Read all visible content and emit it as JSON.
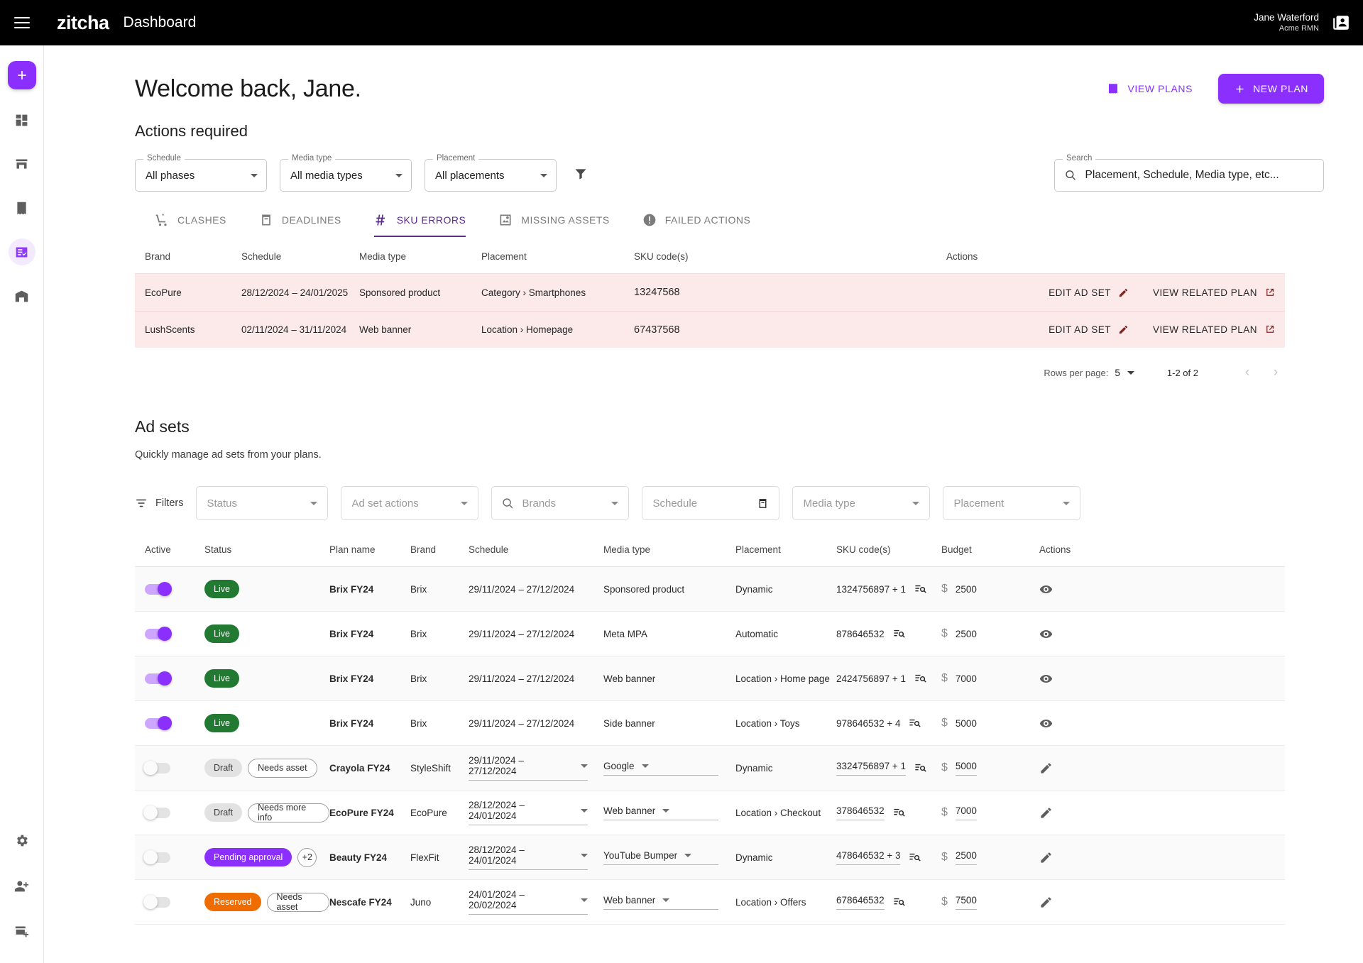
{
  "topbar": {
    "menu_icon": "hamburger-icon",
    "logo": "zitcha",
    "title": "Dashboard",
    "user_name": "Jane Waterford",
    "user_org": "Acme RMN",
    "account_icon": "contact-card-icon"
  },
  "rail": {
    "add_label": "+",
    "items": [
      {
        "icon": "dashboard-grid-icon",
        "name": "sidebar-item-dashboard"
      },
      {
        "icon": "storefront-icon",
        "name": "sidebar-item-retailers"
      },
      {
        "icon": "receipt-icon",
        "name": "sidebar-item-plans"
      },
      {
        "icon": "checklist-icon",
        "name": "sidebar-item-adsets"
      },
      {
        "icon": "warehouse-icon",
        "name": "sidebar-item-inventory"
      }
    ],
    "bottom_items": [
      {
        "icon": "gear-icon",
        "name": "sidebar-item-settings"
      },
      {
        "icon": "person-add-icon",
        "name": "sidebar-item-add-user"
      },
      {
        "icon": "store-add-icon",
        "name": "sidebar-item-add-store"
      }
    ]
  },
  "header": {
    "welcome": "Welcome back, Jane.",
    "view_plans": "VIEW PLANS",
    "new_plan": "NEW PLAN"
  },
  "actions_required": {
    "title": "Actions required",
    "filters": [
      {
        "label": "Schedule",
        "value": "All phases"
      },
      {
        "label": "Media type",
        "value": "All media types"
      },
      {
        "label": "Placement",
        "value": "All placements"
      }
    ],
    "search": {
      "label": "Search",
      "placeholder": "Placement, Schedule, Media type, etc...",
      "value": ""
    },
    "tabs": [
      {
        "label": "CLASHES",
        "icon": "clash-cart-icon",
        "active": false
      },
      {
        "label": "DEADLINES",
        "icon": "calendar-icon",
        "active": false
      },
      {
        "label": "SKU ERRORS",
        "icon": "hash-icon",
        "active": true
      },
      {
        "label": "MISSING ASSETS",
        "icon": "image-search-icon",
        "active": false
      },
      {
        "label": "FAILED ACTIONS",
        "icon": "error-icon",
        "active": false
      }
    ],
    "columns": [
      "Brand",
      "Schedule",
      "Media type",
      "Placement",
      "SKU code(s)",
      "Actions"
    ],
    "rows": [
      {
        "brand": "EcoPure",
        "schedule": "28/12/2024 – 24/01/2025",
        "media_type": "Sponsored product",
        "placement": "Category › Smartphones",
        "sku": "13247568",
        "edit_label": "EDIT AD SET",
        "view_label": "VIEW RELATED PLAN"
      },
      {
        "brand": "LushScents",
        "schedule": "02/11/2024 – 31/11/2024",
        "media_type": "Web banner",
        "placement": "Location › Homepage",
        "sku": "67437568",
        "edit_label": "EDIT AD SET",
        "view_label": "VIEW RELATED PLAN"
      }
    ],
    "pagination": {
      "rows_per_page_label": "Rows per page:",
      "rows_per_page_value": "5",
      "range": "1-2 of 2",
      "prev": "‹",
      "next": "›"
    }
  },
  "adsets": {
    "title": "Ad sets",
    "subtitle": "Quickly manage ad sets from your plans.",
    "filters_label": "Filters",
    "filters": [
      {
        "placeholder": "Status",
        "name": "status-filter",
        "icon": null
      },
      {
        "placeholder": "Ad set actions",
        "name": "adset-actions-filter",
        "icon": null
      },
      {
        "placeholder": "Brands",
        "name": "brands-filter",
        "icon": "search-icon"
      },
      {
        "placeholder": "Schedule",
        "name": "schedule-filter",
        "icon": "calendar-icon"
      },
      {
        "placeholder": "Media type",
        "name": "media-type-filter",
        "icon": null
      },
      {
        "placeholder": "Placement",
        "name": "placement-filter",
        "icon": null
      }
    ],
    "columns": [
      "Active",
      "Status",
      "Plan name",
      "Brand",
      "Schedule",
      "Media type",
      "Placement",
      "SKU code(s)",
      "Budget",
      "Actions"
    ],
    "rows": [
      {
        "active": true,
        "status": "Live",
        "status_kind": "live",
        "extra_chip": null,
        "plan": "Brix FY24",
        "brand": "Brix",
        "schedule": "29/11/2024 – 27/12/2024",
        "schedule_editable": false,
        "media": "Sponsored product",
        "media_editable": false,
        "placement": "Dynamic",
        "sku": "1324756897 + 1",
        "sku_editable": false,
        "budget": "2500",
        "budget_editable": false,
        "action_icon": "eye-icon"
      },
      {
        "active": true,
        "status": "Live",
        "status_kind": "live",
        "extra_chip": null,
        "plan": "Brix FY24",
        "brand": "Brix",
        "schedule": "29/11/2024 – 27/12/2024",
        "schedule_editable": false,
        "media": "Meta MPA",
        "media_editable": false,
        "placement": "Automatic",
        "sku": "878646532",
        "sku_editable": false,
        "budget": "2500",
        "budget_editable": false,
        "action_icon": "eye-icon"
      },
      {
        "active": true,
        "status": "Live",
        "status_kind": "live",
        "extra_chip": null,
        "plan": "Brix FY24",
        "brand": "Brix",
        "schedule": "29/11/2024 – 27/12/2024",
        "schedule_editable": false,
        "media": "Web banner",
        "media_editable": false,
        "placement": "Location › Home page",
        "sku": "2424756897 + 1",
        "sku_editable": false,
        "budget": "7000",
        "budget_editable": false,
        "action_icon": "eye-icon"
      },
      {
        "active": true,
        "status": "Live",
        "status_kind": "live",
        "extra_chip": null,
        "plan": "Brix FY24",
        "brand": "Brix",
        "schedule": "29/11/2024 – 27/12/2024",
        "schedule_editable": false,
        "media": "Side banner",
        "media_editable": false,
        "placement": "Location › Toys",
        "sku": "978646532 + 4",
        "sku_editable": false,
        "budget": "5000",
        "budget_editable": false,
        "action_icon": "eye-icon"
      },
      {
        "active": false,
        "status": "Draft",
        "status_kind": "draft",
        "extra_chip": "Needs asset",
        "plan": "Crayola FY24",
        "brand": "StyleShift",
        "schedule": "29/11/2024 – 27/12/2024",
        "schedule_editable": true,
        "media": "Google",
        "media_editable": true,
        "placement": "Dynamic",
        "sku": "3324756897 + 1",
        "sku_editable": true,
        "budget": "5000",
        "budget_editable": true,
        "action_icon": "pencil-icon"
      },
      {
        "active": false,
        "status": "Draft",
        "status_kind": "draft",
        "extra_chip": "Needs more info",
        "plan": "EcoPure FY24",
        "brand": "EcoPure",
        "schedule": "28/12/2024 – 24/01/2024",
        "schedule_editable": true,
        "media": "Web banner",
        "media_editable": true,
        "placement": "Location › Checkout",
        "sku": "378646532",
        "sku_editable": true,
        "budget": "7000",
        "budget_editable": true,
        "action_icon": "pencil-icon"
      },
      {
        "active": false,
        "status": "Pending approval",
        "status_kind": "pending",
        "extra_chip": "+2",
        "plan": "Beauty FY24",
        "brand": "FlexFit",
        "schedule": "28/12/2024 – 24/01/2024",
        "schedule_editable": true,
        "media": "YouTube Bumper",
        "media_editable": true,
        "placement": "Dynamic",
        "sku": "478646532 + 3",
        "sku_editable": true,
        "budget": "2500",
        "budget_editable": true,
        "action_icon": "pencil-icon"
      },
      {
        "active": false,
        "status": "Reserved",
        "status_kind": "reserved",
        "extra_chip": "Needs asset",
        "plan": "Nescafe FY24",
        "brand": "Juno",
        "schedule": "24/01/2024 – 20/02/2024",
        "schedule_editable": true,
        "media": "Web banner",
        "media_editable": true,
        "placement": "Location › Offers",
        "sku": "678646532",
        "sku_editable": true,
        "budget": "7500",
        "budget_editable": true,
        "action_icon": "pencil-icon"
      }
    ]
  },
  "colors": {
    "accent": "#8b2fff",
    "tab_active": "#5b2b8a",
    "error_row_bg": "#fce9e9",
    "error_text": "#802424",
    "live": "#227a32",
    "reserved": "#ef6c00"
  }
}
